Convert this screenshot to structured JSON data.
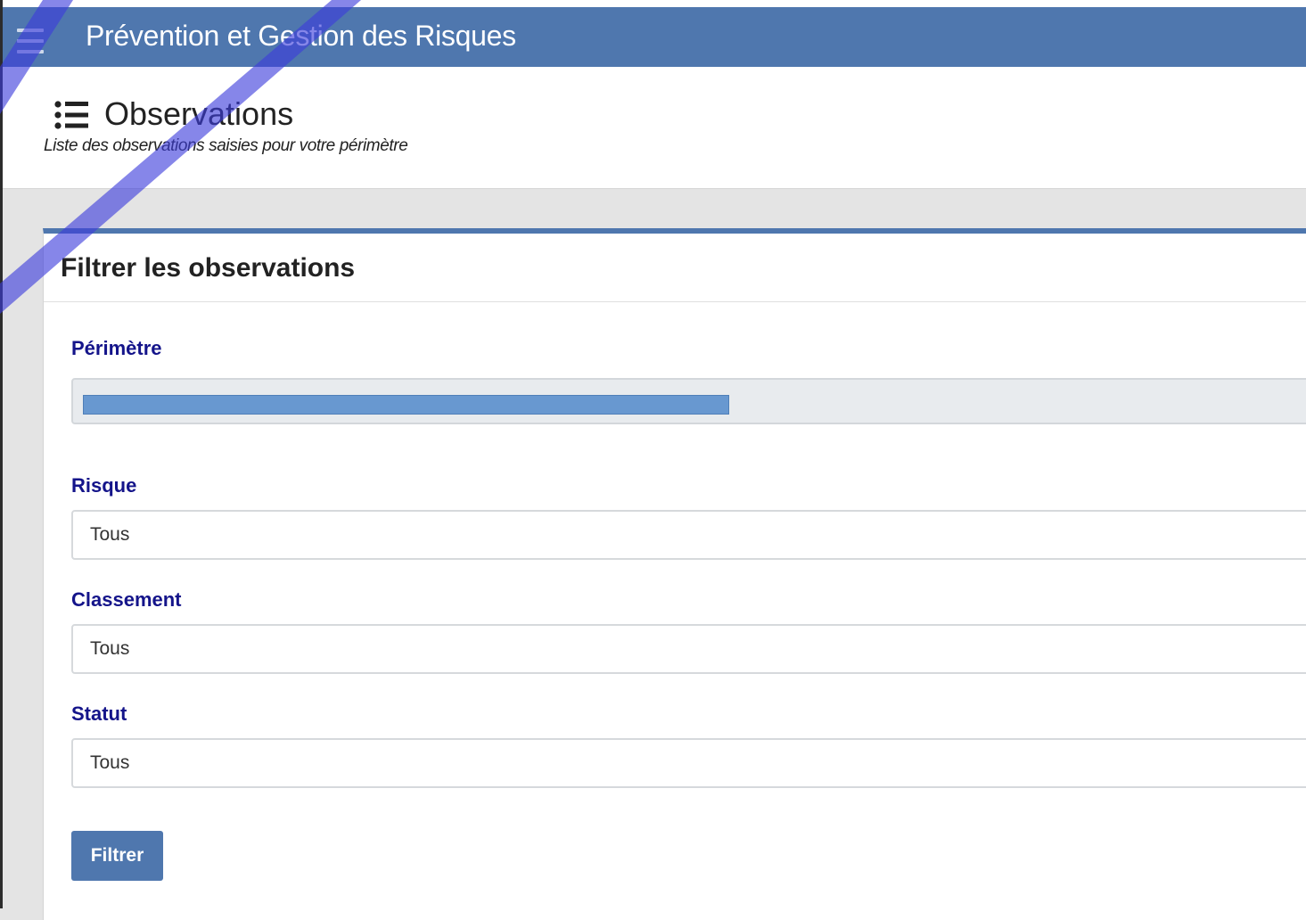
{
  "app": {
    "title": "Prévention et Gestion des Risques",
    "menu_icon": "hamburger-menu-icon"
  },
  "page_header": {
    "icon": "list-icon",
    "title": "Observations",
    "subtitle": "Liste des observations saisies pour votre périmètre"
  },
  "filter_card": {
    "title": "Filtrer les observations",
    "perimetre": {
      "label": "Périmètre",
      "value": ""
    },
    "risque": {
      "label": "Risque",
      "value": "Tous"
    },
    "classement": {
      "label": "Classement",
      "value": "Tous"
    },
    "statut": {
      "label": "Statut",
      "value": "Tous"
    },
    "submit_label": "Filtrer"
  },
  "colors": {
    "primary": "#4f77ae",
    "label": "#14148a",
    "readonly_fill": "#6898d0",
    "overlay_stroke": "#3c3cdc"
  }
}
